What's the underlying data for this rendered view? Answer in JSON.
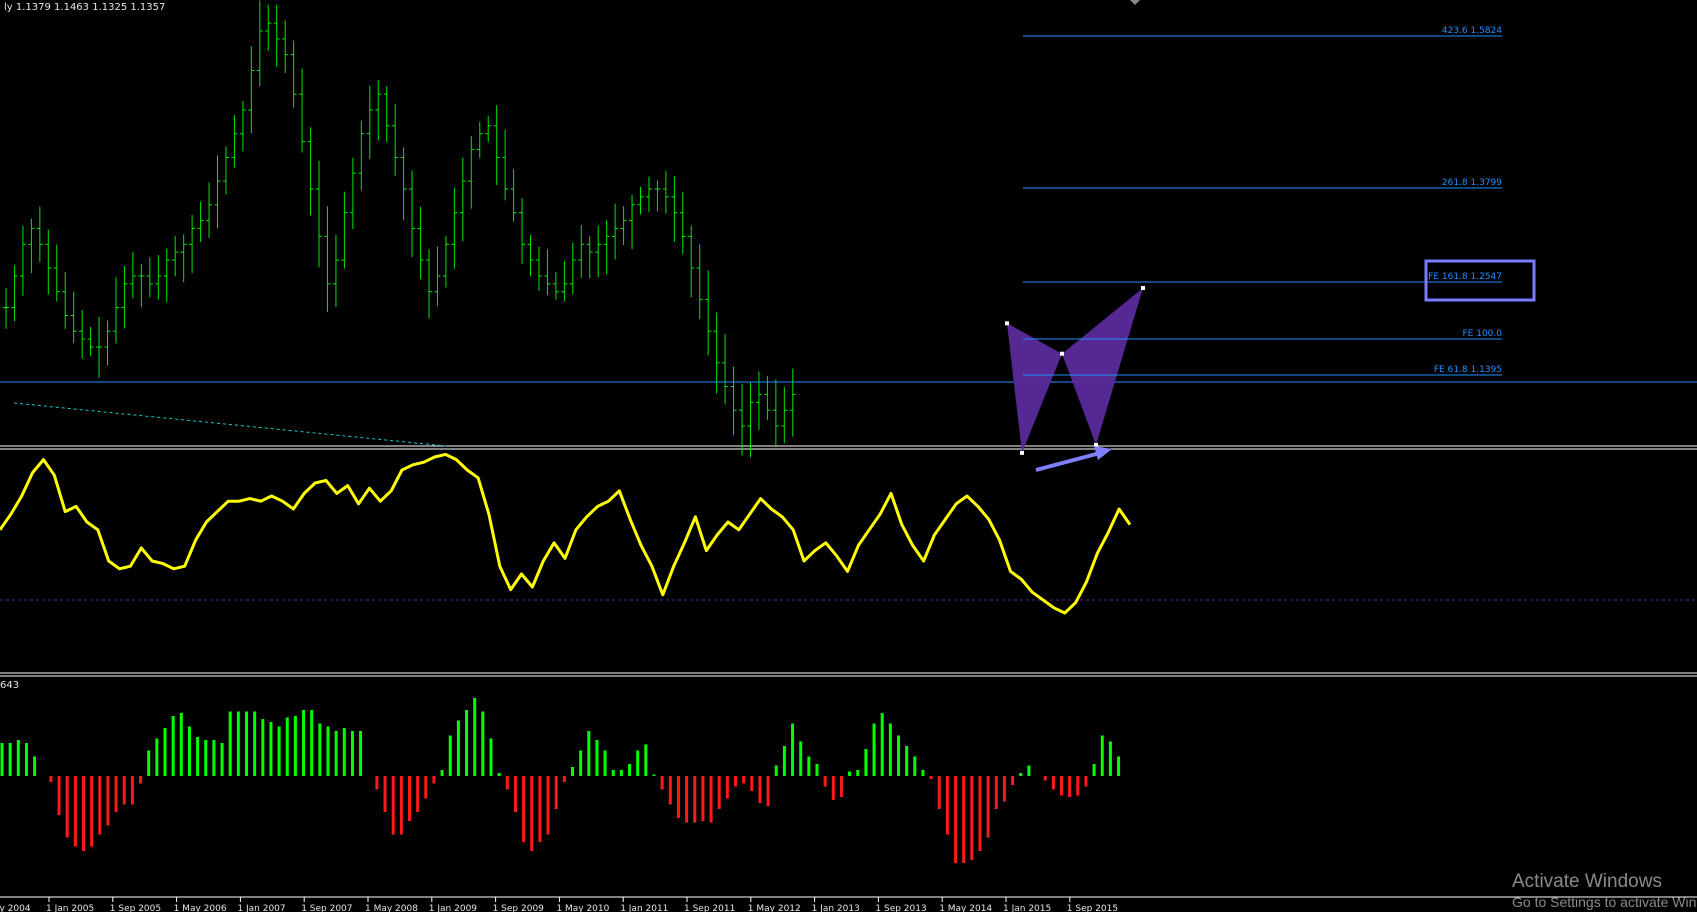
{
  "symbol_header": "ly  1.1379 1.1463 1.1325 1.1357",
  "histogram_header": "643",
  "colors": {
    "background": "#000000",
    "price_bars": "#00e600",
    "level_lines": "#1e90ff",
    "pattern_fill": "#5b2a9c",
    "oscillator": "#ffff00",
    "histogram_up": "#00ff00",
    "histogram_down": "#ff1a1a",
    "separator": "#ffffff",
    "highlight_box": "#7b7bff",
    "arrow": "#8080ff"
  },
  "fib_levels": [
    {
      "label": "423.6 1.5824"
    },
    {
      "label": "261.8 1.3799"
    },
    {
      "label": "FE 161.8 1.2547"
    },
    {
      "label": "FE 100.0"
    },
    {
      "label": "FE 61.8 1.1395"
    }
  ],
  "chart_data": [
    {
      "type": "ohlc",
      "title": "",
      "x_ticks": [
        "ay 2004",
        "1 Jan 2005",
        "1 Sep 2005",
        "1 May 2006",
        "1 Jan 2007",
        "1 Sep 2007",
        "1 May 2008",
        "1 Jan 2009",
        "1 Sep 2009",
        "1 May 2010",
        "1 Jan 2011",
        "1 Sep 2011",
        "1 May 2012",
        "1 Jan 2013",
        "1 Sep 2013",
        "1 May 2014",
        "1 Jan 2015",
        "1 Sep 2015"
      ],
      "close_path": [
        1.23,
        1.27,
        1.31,
        1.33,
        1.31,
        1.28,
        1.25,
        1.22,
        1.2,
        1.19,
        1.18,
        1.18,
        1.2,
        1.23,
        1.26,
        1.27,
        1.27,
        1.26,
        1.27,
        1.29,
        1.3,
        1.31,
        1.33,
        1.34,
        1.36,
        1.39,
        1.42,
        1.45,
        1.48,
        1.53,
        1.58,
        1.59,
        1.57,
        1.55,
        1.5,
        1.44,
        1.38,
        1.32,
        1.26,
        1.29,
        1.35,
        1.4,
        1.45,
        1.48,
        1.5,
        1.46,
        1.42,
        1.38,
        1.33,
        1.29,
        1.25,
        1.27,
        1.31,
        1.35,
        1.39,
        1.43,
        1.45,
        1.46,
        1.42,
        1.38,
        1.35,
        1.31,
        1.29,
        1.27,
        1.26,
        1.25,
        1.26,
        1.29,
        1.31,
        1.3,
        1.31,
        1.32,
        1.33,
        1.34,
        1.36,
        1.37,
        1.38,
        1.38,
        1.37,
        1.35,
        1.32,
        1.28,
        1.24,
        1.2,
        1.16,
        1.13,
        1.1,
        1.08,
        1.11,
        1.12,
        1.1,
        1.08,
        1.1,
        1.12
      ],
      "last_bar": {
        "open": 1.1379,
        "high": 1.1463,
        "low": 1.1325,
        "close": 1.1357
      },
      "pattern": {
        "type": "butterfly",
        "points": [
          {
            "name": "X",
            "price": 1.21
          },
          {
            "name": "A",
            "price": 1.046
          },
          {
            "name": "B",
            "price": 1.1715
          },
          {
            "name": "C",
            "price": 1.056
          },
          {
            "name": "D",
            "price": 1.2547
          }
        ]
      },
      "horizontal_level": 1.1357
    },
    {
      "type": "line",
      "title": "",
      "values": [
        52,
        58,
        65,
        74,
        79,
        73,
        59,
        61,
        55,
        52,
        40,
        37,
        38,
        45,
        40,
        39,
        37,
        38,
        48,
        55,
        59,
        63,
        63,
        64,
        63,
        65,
        63,
        60,
        66,
        70,
        71,
        66,
        69,
        62,
        68,
        63,
        67,
        75,
        77,
        78,
        80,
        81,
        79,
        75,
        72,
        58,
        38,
        29,
        35,
        30,
        40,
        47,
        41,
        52,
        57,
        61,
        63,
        67,
        56,
        46,
        38,
        27,
        38,
        47,
        57,
        44,
        50,
        55,
        52,
        58,
        64,
        60,
        57,
        52,
        40,
        44,
        47,
        42,
        36,
        46,
        52,
        58,
        66,
        54,
        46,
        40,
        50,
        56,
        62,
        65,
        61,
        56,
        48,
        36,
        33,
        28,
        25,
        22,
        20,
        24,
        32,
        43,
        51,
        60,
        54
      ],
      "ylim": [
        0,
        100
      ],
      "reference_level": 36
    },
    {
      "type": "bar",
      "title": "",
      "values": [
        2.2,
        2.2,
        2.4,
        2.2,
        1.3,
        0,
        -0.4,
        -2.6,
        -4.1,
        -4.7,
        -5.0,
        -4.7,
        -3.9,
        -3.3,
        -2.4,
        -1.9,
        -1.9,
        -0.5,
        1.7,
        2.5,
        3.2,
        4.0,
        4.2,
        3.3,
        2.6,
        2.4,
        2.4,
        2.2,
        4.3,
        4.3,
        4.3,
        4.3,
        3.8,
        3.6,
        3.3,
        3.9,
        4.0,
        4.4,
        4.4,
        3.5,
        3.3,
        3.0,
        3.2,
        3.0,
        3.0,
        0,
        -0.9,
        -2.4,
        -3.9,
        -3.9,
        -3.0,
        -2.4,
        -1.5,
        -0.5,
        0.4,
        2.7,
        3.7,
        4.4,
        5.2,
        4.3,
        2.5,
        0.2,
        -0.9,
        -2.4,
        -4.4,
        -5.0,
        -4.4,
        -3.9,
        -2.2,
        -0.4,
        0.6,
        1.7,
        3.0,
        2.4,
        1.7,
        0.4,
        0.4,
        0.8,
        1.7,
        2.1,
        0.1,
        -0.9,
        -1.9,
        -2.8,
        -3.1,
        -3.1,
        -3.0,
        -3.1,
        -2.2,
        -1.5,
        -0.7,
        -0.5,
        -1.0,
        -1.8,
        -2.0,
        0.7,
        2.0,
        3.5,
        2.3,
        1.3,
        0.8,
        -0.7,
        -1.6,
        -1.4,
        0.3,
        0.4,
        1.8,
        3.5,
        4.2,
        3.5,
        2.7,
        2.0,
        1.3,
        0.4,
        -0.2,
        -2.2,
        -3.9,
        -5.8,
        -5.8,
        -5.6,
        -5.0,
        -4.1,
        -2.2,
        -1.7,
        -0.6,
        0.2,
        0.7,
        0,
        -0.3,
        -0.9,
        -1.3,
        -1.4,
        -1.3,
        -0.7,
        0.8,
        2.7,
        2.3,
        1.3
      ],
      "baseline": 0
    }
  ],
  "watermark": {
    "line1": "Activate Windows",
    "line2": "Go to Settings to activate Windows."
  }
}
